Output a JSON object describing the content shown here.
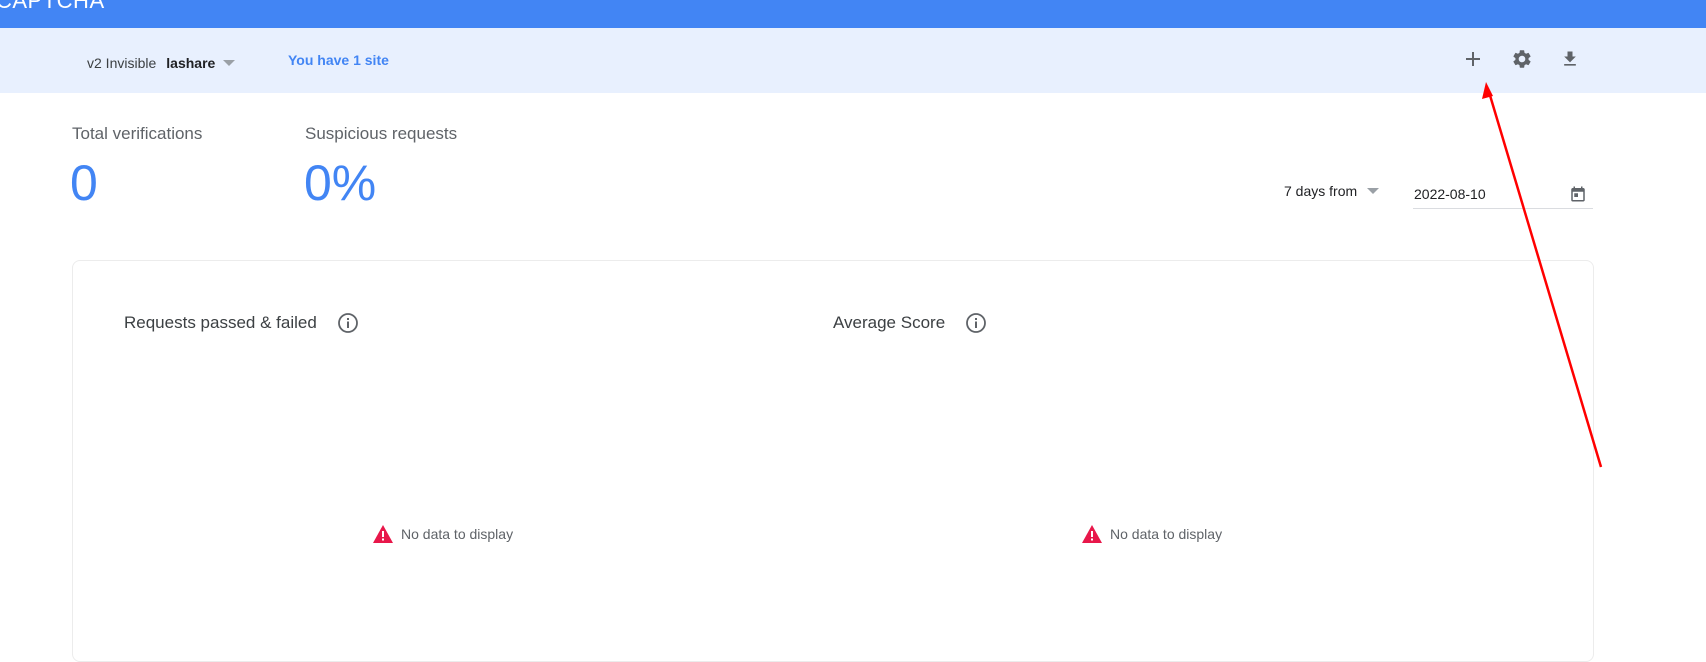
{
  "header": {
    "app_title": "CAPTCHA"
  },
  "site_bar": {
    "site_type": "v2 Invisible",
    "site_name": "lashare",
    "site_count_text": "You have 1 site",
    "actions": [
      {
        "icon": "plus-icon"
      },
      {
        "icon": "gear-icon"
      },
      {
        "icon": "download-icon"
      }
    ]
  },
  "metrics": {
    "total_verifications": {
      "label": "Total verifications",
      "value": "0"
    },
    "suspicious_requests": {
      "label": "Suspicious requests",
      "value": "0%"
    }
  },
  "date_range": {
    "range_label": "7 days from",
    "date_value": "2022-08-10"
  },
  "panels": {
    "requests": {
      "title": "Requests passed & failed",
      "empty_text": "No data to display"
    },
    "average_score": {
      "title": "Average Score",
      "empty_text": "No data to display"
    }
  },
  "colors": {
    "primary": "#4285f4",
    "subbar": "#e8f0fe",
    "warning": "#e8174a",
    "annotation_arrow": "#ff0000"
  }
}
